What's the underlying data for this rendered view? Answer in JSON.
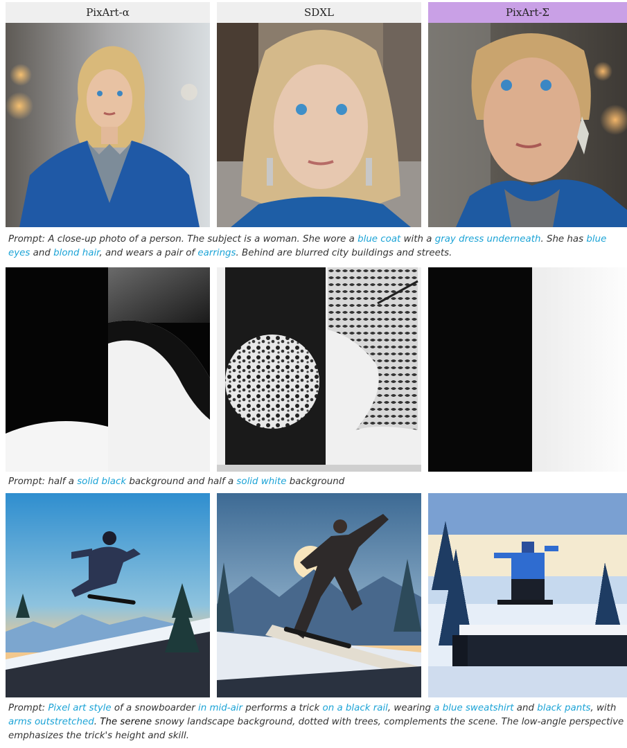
{
  "headers": {
    "col1": "PixArt-α",
    "col2": "SDXL",
    "col3": "PixArt-Σ"
  },
  "colors": {
    "highlight": "#1ba3d6",
    "sigma_header_bg": "#c9a0e6",
    "header_bg": "#efefef"
  },
  "row1_caption": [
    {
      "t": "Prompt: A close-up photo of a person. The subject is a woman. She wore a "
    },
    {
      "t": "blue coat",
      "hl": true
    },
    {
      "t": " with a "
    },
    {
      "t": "gray dress underneath",
      "hl": true
    },
    {
      "t": ". She has "
    },
    {
      "t": "blue eyes",
      "hl": true
    },
    {
      "t": " and "
    },
    {
      "t": "blond hair",
      "hl": true
    },
    {
      "t": ", and wears a pair of "
    },
    {
      "t": "earrings",
      "hl": true
    },
    {
      "t": ". Behind are blurred city buildings and streets."
    }
  ],
  "row2_caption": [
    {
      "t": "Prompt: half a "
    },
    {
      "t": "solid black",
      "hl": true
    },
    {
      "t": " background and half a "
    },
    {
      "t": "solid white",
      "hl": true
    },
    {
      "t": " background"
    }
  ],
  "row3_caption": [
    {
      "t": "Prompt: "
    },
    {
      "t": "Pixel art style",
      "hl": true
    },
    {
      "t": " of a snowboarder "
    },
    {
      "t": "in mid-air",
      "hl": true
    },
    {
      "t": " performs a trick "
    },
    {
      "t": "on a black rail",
      "hl": true
    },
    {
      "t": ", wearing "
    },
    {
      "t": "a blue sweatshirt",
      "hl": true
    },
    {
      "t": " and "
    },
    {
      "t": "black pants",
      "hl": true
    },
    {
      "t": ", with "
    },
    {
      "t": "arms outstretched",
      "hl": true
    },
    {
      "t": ". "
    },
    {
      "t": "The serene",
      "bk": true
    },
    {
      "t": " snowy landscape background, dotted with trees, complements the scene. The low-angle perspective emphasizes the trick's height and skill."
    }
  ]
}
